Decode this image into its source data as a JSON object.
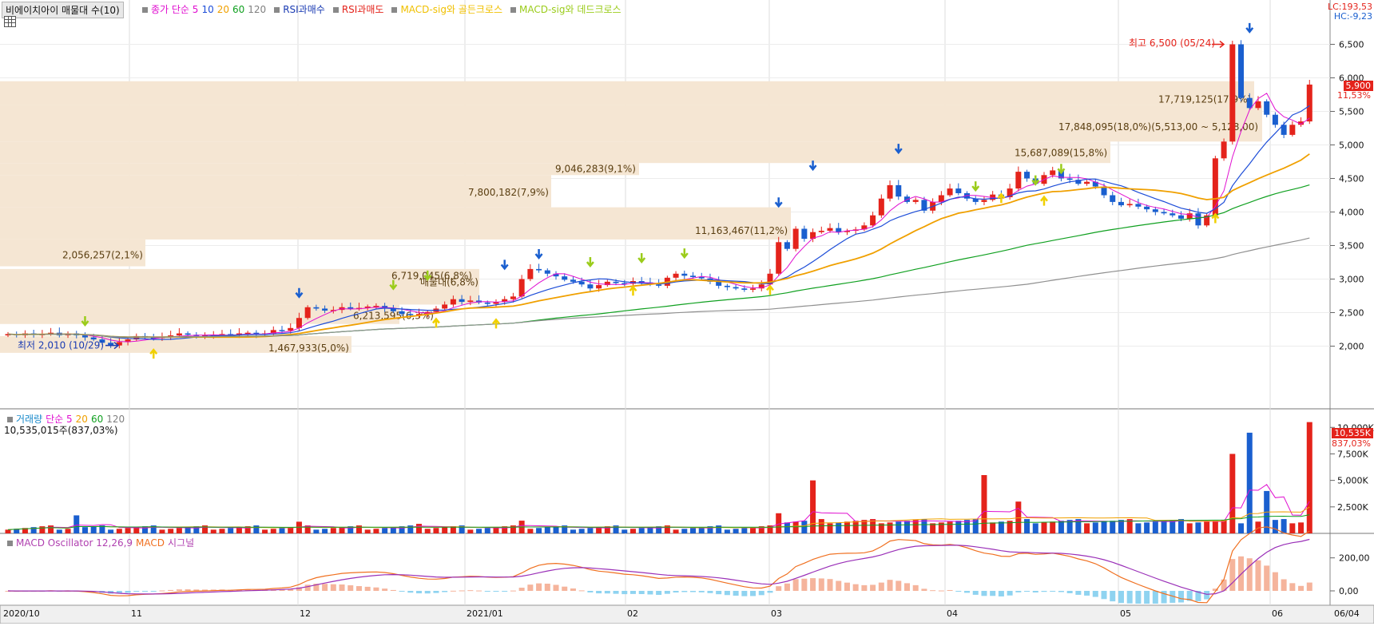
{
  "header": {
    "title": "비에이치아이 매물대 수(10)",
    "legend_items": [
      {
        "label": "종가 단순 5",
        "color": "#e00fd0"
      },
      {
        "label": "10",
        "color": "#1d4dd8"
      },
      {
        "label": "20",
        "color": "#f0a000"
      },
      {
        "label": "60",
        "color": "#10a020"
      },
      {
        "label": "120",
        "color": "#808080"
      },
      {
        "label": "RSI과매수",
        "color": "#1a3bb3"
      },
      {
        "label": "RSI과매도",
        "color": "#e4231b"
      },
      {
        "label": "MACD-sig와 골든크로스",
        "color": "#f0c000"
      },
      {
        "label": "MACD-sig와 데드크로스",
        "color": "#9bcc1b"
      }
    ],
    "lc": "LC:193,53",
    "hc": "HC:-9,23"
  },
  "price_panel": {
    "y_ticks": [
      "6,500",
      "6,000",
      "5,500",
      "5,000",
      "4,500",
      "4,000",
      "3,500",
      "3,000",
      "2,500",
      "2,000"
    ],
    "current_price": "5,900",
    "current_change": "11,53%",
    "high_note": "최고 6,500 (05/24)",
    "low_note": "최저 2,010 (10/29)",
    "volume_profile": [
      {
        "label": "1,467,933(5,0%)"
      },
      {
        "label": "6,213,595(6,3%)"
      },
      {
        "label": "6,719,045(6,8%)"
      },
      {
        "label": "2,056,257(2,1%)"
      },
      {
        "label": "11,163,467(11,2%)"
      },
      {
        "label": "7,800,182(7,9%)"
      },
      {
        "label": "9,046,283(9,1%)"
      },
      {
        "label": "15,687,089(15,8%)"
      },
      {
        "label": "17,848,095(18,0%)(5,513,00 ~ 5,128,00)"
      },
      {
        "label": "17,719,125(17,9%)"
      }
    ],
    "peak_note": "매물대(6,8%)"
  },
  "volume_panel": {
    "legend": [
      {
        "label": "거래량",
        "color": "#1a8acb"
      },
      {
        "label": "단순 5",
        "color": "#e00fd0"
      },
      {
        "label": "20",
        "color": "#f0a000"
      },
      {
        "label": "60",
        "color": "#10a020"
      },
      {
        "label": "120",
        "color": "#808080"
      }
    ],
    "summary": "10,535,015주(837,03%)",
    "y_ticks": [
      "10,000K",
      "7,500K",
      "5,000K",
      "2,500K"
    ],
    "current_volume": "10,535K",
    "current_pct": "837,03%"
  },
  "macd_panel": {
    "legend": [
      {
        "label": "MACD Oscillator 12,26,9",
        "color": "#b040b0"
      },
      {
        "label": "MACD",
        "color": "#f07020"
      },
      {
        "label": "시그널",
        "color": "#b040b0"
      }
    ],
    "y_ticks": [
      "200,00",
      "0,00"
    ]
  },
  "date_axis": [
    "2020/10",
    "11",
    "12",
    "2021/01",
    "02",
    "03",
    "04",
    "05",
    "06",
    "06/04"
  ],
  "colors": {
    "up": "#e4231b",
    "down": "#1a5fcf",
    "ma5": "#e00fd0",
    "ma10": "#1d4dd8",
    "ma20": "#f0a000",
    "ma60": "#10a020",
    "ma120": "#909090",
    "profile": "#f5e6d3",
    "macd": "#f07020",
    "signal": "#9a30b8",
    "osc_up": "#f5b49c",
    "osc_down": "#8fd3f0"
  }
}
